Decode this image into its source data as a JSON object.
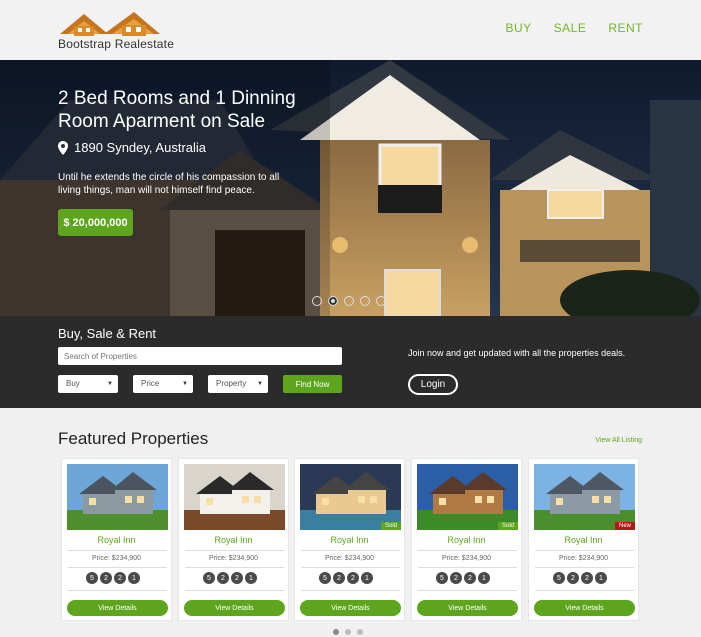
{
  "header": {
    "logo_text": "Bootstrap Realestate",
    "nav": [
      "BUY",
      "SALE",
      "RENT"
    ]
  },
  "hero": {
    "title": "2 Bed Rooms and 1 Dinning Room Aparment on Sale",
    "location": "1890 Syndey, Australia",
    "description": "Until he extends the circle of his compassion to all living things, man will not himself find peace.",
    "price": "$ 20,000,000",
    "slide_count": 5,
    "active_slide": 2
  },
  "search": {
    "title": "Buy, Sale & Rent",
    "placeholder": "Search of Properties",
    "selects": [
      "Buy",
      "Price",
      "Property"
    ],
    "find_label": "Find Now",
    "join_text": "Join now and get updated with all the properties deals.",
    "login_label": "Login"
  },
  "featured": {
    "title": "Featured Properties",
    "view_all": "View All Listing",
    "cards": [
      {
        "name": "Royal Inn",
        "price": "Price: $234,900",
        "feats": [
          "5",
          "2",
          "2",
          "1"
        ],
        "tag": "",
        "button": "View Details"
      },
      {
        "name": "Royal Inn",
        "price": "Price: $234,900",
        "feats": [
          "5",
          "2",
          "2",
          "1"
        ],
        "tag": "",
        "button": "View Details"
      },
      {
        "name": "Royal Inn",
        "price": "Price: $234,900",
        "feats": [
          "5",
          "2",
          "2",
          "1"
        ],
        "tag": "Sold",
        "button": "View Details"
      },
      {
        "name": "Royal Inn",
        "price": "Price: $234,900",
        "feats": [
          "5",
          "2",
          "2",
          "1"
        ],
        "tag": "Sold",
        "button": "View Details"
      },
      {
        "name": "Royal Inn",
        "price": "Price: $234,900",
        "feats": [
          "5",
          "2",
          "2",
          "1"
        ],
        "tag": "New",
        "button": "View Details"
      }
    ],
    "page_count": 3,
    "active_page": 1
  },
  "colors": {
    "accent": "#5ea51e",
    "dark_band": "#2b2b2b"
  }
}
